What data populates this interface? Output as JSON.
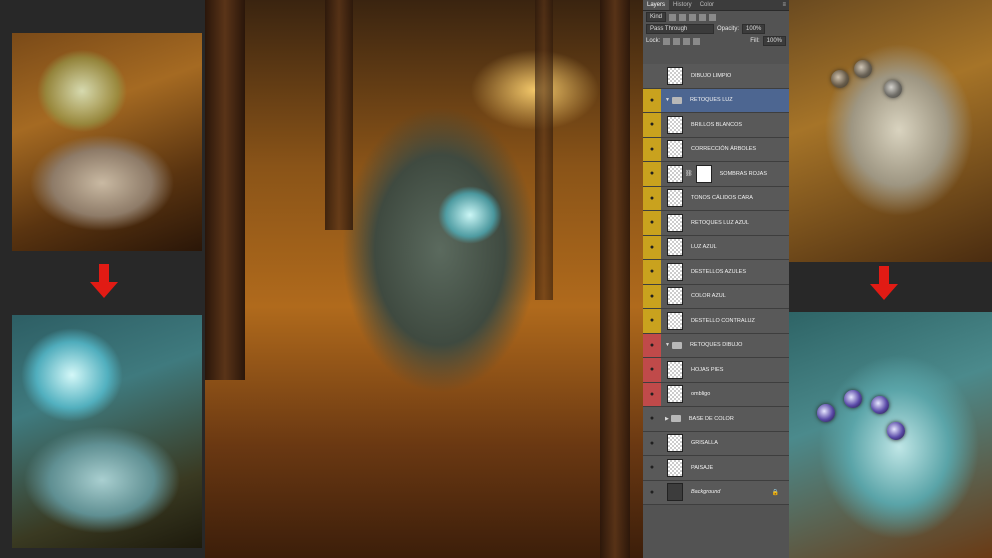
{
  "panel": {
    "tabs": [
      "Layers",
      "History",
      "Color"
    ],
    "menu_icon": "≡",
    "filter_kind": "Kind",
    "blend_mode": "Pass Through",
    "opacity_label": "Opacity:",
    "opacity_value": "100%",
    "lock_label": "Lock:",
    "fill_label": "Fill:",
    "fill_value": "100%"
  },
  "layers": [
    {
      "name": "DIBUJO LIMPIO",
      "type": "layer",
      "color": "none"
    },
    {
      "name": "RETOQUES LUZ",
      "type": "group",
      "color": "yellow"
    },
    {
      "name": "BRILLOS BLANCOS",
      "type": "layer",
      "color": "yellow"
    },
    {
      "name": "CORRECCIÓN ÁRBOLES",
      "type": "layer",
      "color": "yellow"
    },
    {
      "name": "SOMBRAS ROJAS",
      "type": "masked",
      "color": "yellow"
    },
    {
      "name": "TONOS CÁLIDOS CARA",
      "type": "layer",
      "color": "yellow"
    },
    {
      "name": "RETOQUES LUZ AZUL",
      "type": "layer",
      "color": "yellow"
    },
    {
      "name": "LUZ AZUL",
      "type": "layer",
      "color": "yellow"
    },
    {
      "name": "DESTELLOS AZULES",
      "type": "layer",
      "color": "yellow"
    },
    {
      "name": "COLOR AZUL",
      "type": "layer",
      "color": "yellow"
    },
    {
      "name": "DESTELLO CONTRALUZ",
      "type": "layer",
      "color": "yellow"
    },
    {
      "name": "RETOQUES DIBUJO",
      "type": "group",
      "color": "red"
    },
    {
      "name": "HOJAS PIES",
      "type": "layer",
      "color": "red"
    },
    {
      "name": "ombligo",
      "type": "layer",
      "color": "red"
    },
    {
      "name": "BASE DE COLOR",
      "type": "group-closed",
      "color": "none"
    },
    {
      "name": "GRISALLA",
      "type": "layer",
      "color": "none"
    },
    {
      "name": "PAISAJE",
      "type": "layer",
      "color": "none"
    },
    {
      "name": "Background",
      "type": "bg",
      "color": "none"
    }
  ],
  "colors": {
    "arrow": "#e11b14",
    "yellow_tag": "#c9a21e",
    "red_tag": "#c04a4a",
    "panel_bg": "#535353"
  }
}
